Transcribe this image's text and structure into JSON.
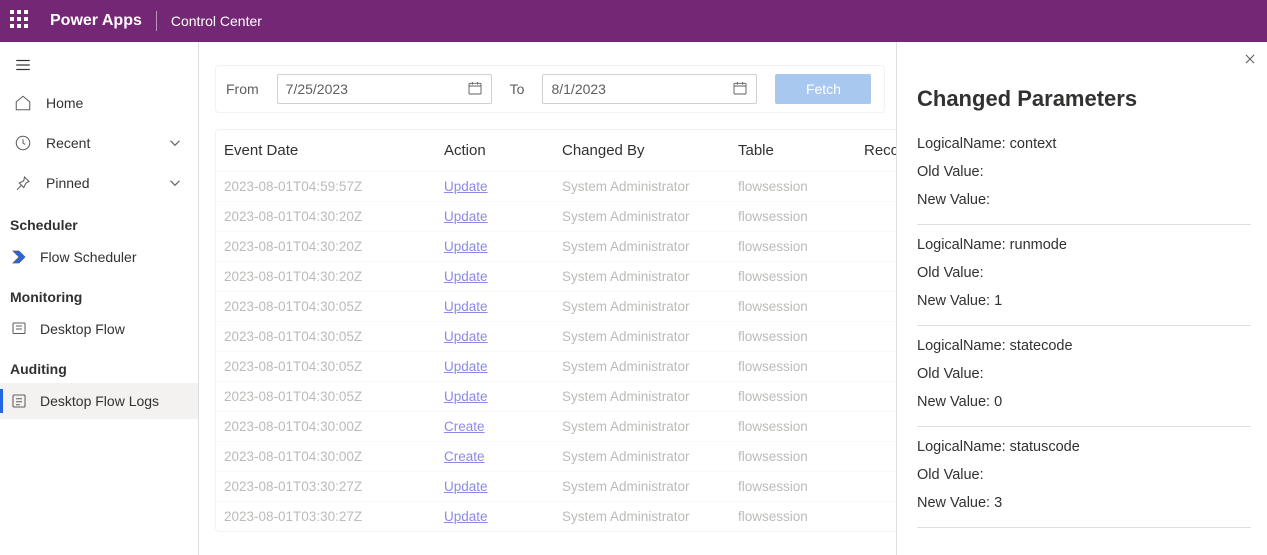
{
  "header": {
    "appName": "Power Apps",
    "environment": "Control Center"
  },
  "sidebar": {
    "home": "Home",
    "recent": "Recent",
    "pinned": "Pinned",
    "sections": {
      "scheduler": {
        "title": "Scheduler",
        "items": [
          "Flow Scheduler"
        ]
      },
      "monitoring": {
        "title": "Monitoring",
        "items": [
          "Desktop Flow"
        ]
      },
      "auditing": {
        "title": "Auditing",
        "items": [
          "Desktop Flow Logs"
        ]
      }
    }
  },
  "filters": {
    "fromLabel": "From",
    "fromValue": "7/25/2023",
    "toLabel": "To",
    "toValue": "8/1/2023",
    "fetch": "Fetch"
  },
  "grid": {
    "columns": {
      "date": "Event Date",
      "action": "Action",
      "changedBy": "Changed By",
      "table": "Table",
      "record": "Reco"
    },
    "rows": [
      {
        "date": "2023-08-01T04:59:57Z",
        "action": "Update",
        "changedBy": "System Administrator",
        "table": "flowsession"
      },
      {
        "date": "2023-08-01T04:30:20Z",
        "action": "Update",
        "changedBy": "System Administrator",
        "table": "flowsession"
      },
      {
        "date": "2023-08-01T04:30:20Z",
        "action": "Update",
        "changedBy": "System Administrator",
        "table": "flowsession"
      },
      {
        "date": "2023-08-01T04:30:20Z",
        "action": "Update",
        "changedBy": "System Administrator",
        "table": "flowsession"
      },
      {
        "date": "2023-08-01T04:30:05Z",
        "action": "Update",
        "changedBy": "System Administrator",
        "table": "flowsession"
      },
      {
        "date": "2023-08-01T04:30:05Z",
        "action": "Update",
        "changedBy": "System Administrator",
        "table": "flowsession"
      },
      {
        "date": "2023-08-01T04:30:05Z",
        "action": "Update",
        "changedBy": "System Administrator",
        "table": "flowsession"
      },
      {
        "date": "2023-08-01T04:30:05Z",
        "action": "Update",
        "changedBy": "System Administrator",
        "table": "flowsession"
      },
      {
        "date": "2023-08-01T04:30:00Z",
        "action": "Create",
        "changedBy": "System Administrator",
        "table": "flowsession"
      },
      {
        "date": "2023-08-01T04:30:00Z",
        "action": "Create",
        "changedBy": "System Administrator",
        "table": "flowsession"
      },
      {
        "date": "2023-08-01T03:30:27Z",
        "action": "Update",
        "changedBy": "System Administrator",
        "table": "flowsession"
      },
      {
        "date": "2023-08-01T03:30:27Z",
        "action": "Update",
        "changedBy": "System Administrator",
        "table": "flowsession"
      }
    ]
  },
  "panel": {
    "title": "Changed Parameters",
    "labels": {
      "logical": "LogicalName:",
      "old": "Old Value:",
      "new": "New Value:"
    },
    "params": [
      {
        "logical": "context",
        "old": "",
        "new": ""
      },
      {
        "logical": "runmode",
        "old": "",
        "new": "1"
      },
      {
        "logical": "statecode",
        "old": "",
        "new": "0"
      },
      {
        "logical": "statuscode",
        "old": "",
        "new": "3"
      }
    ]
  }
}
